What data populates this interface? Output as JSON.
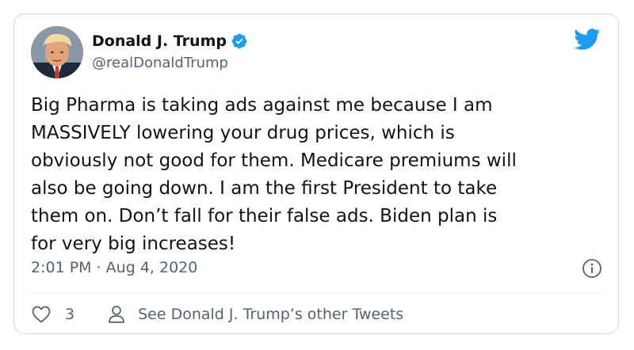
{
  "tweet": {
    "author": {
      "display_name": "Donald J. Trump",
      "handle": "@realDonaldTrump",
      "verified": true
    },
    "text": "Big Pharma is taking ads against me because I am\nMASSIVELY lowering your drug prices, which is\nobviously not good for them. Medicare premiums will\nalso be going down. I am the first President to take\nthem on. Don’t fall for their false ads. Biden plan is\nfor very big increases!",
    "timestamp": "2:01 PM · Aug 4, 2020",
    "likes": "3",
    "profile_link_label": "See Donald J. Trump’s other Tweets"
  },
  "icons": {
    "brand": "twitter-bird-icon",
    "verified": "verified-badge-icon",
    "info": "info-icon",
    "like": "heart-icon",
    "profile": "person-icon"
  },
  "colors": {
    "brand_blue": "#1d9bf0",
    "text_primary": "#0f1419",
    "text_secondary": "#536471",
    "border": "#cfd9de"
  }
}
